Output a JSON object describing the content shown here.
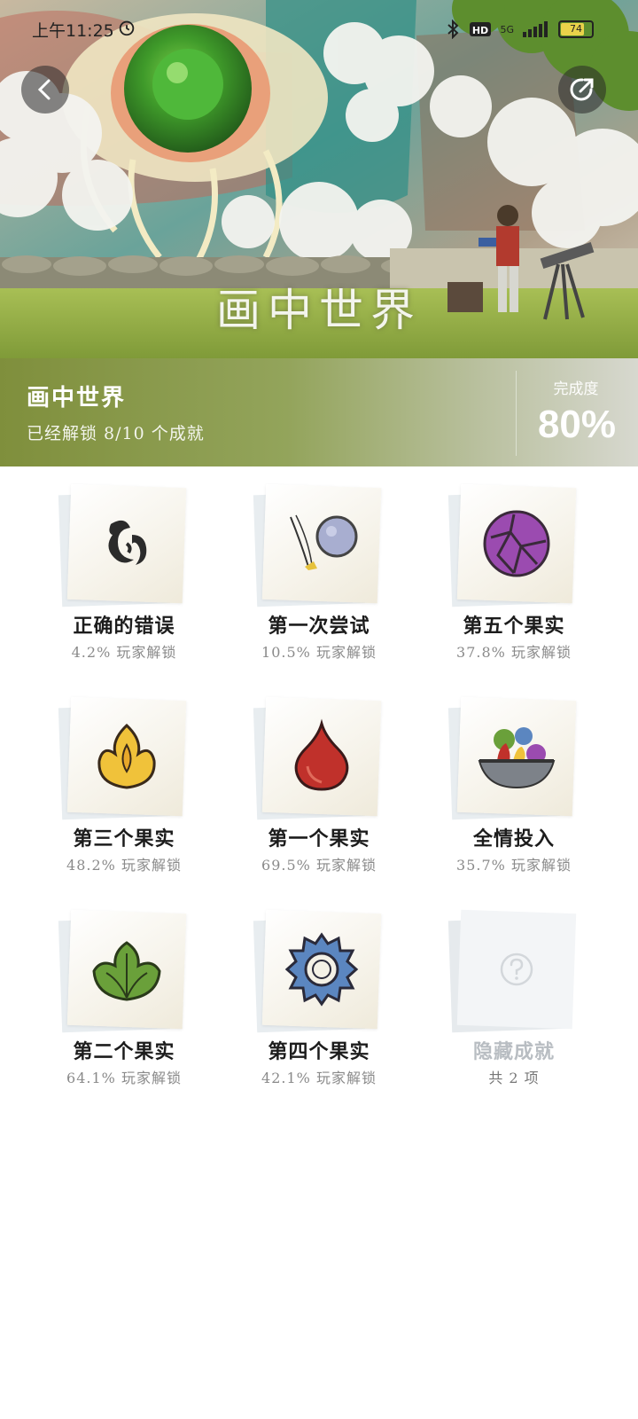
{
  "status_bar": {
    "time": "上午11:25",
    "battery": "74",
    "network": "5G"
  },
  "hero": {
    "title_art_text": "画中世界"
  },
  "summary": {
    "game_name": "画中世界",
    "unlocked_text": "已经解锁 8/10 个成就",
    "completion_label": "完成度",
    "completion_value": "80%"
  },
  "achievements": [
    {
      "name": "正确的错误",
      "rate": "4.2% 玩家解锁",
      "icon": "swirl-glyph-icon"
    },
    {
      "name": "第一次尝试",
      "rate": "10.5% 玩家解锁",
      "icon": "thrown-ball-icon"
    },
    {
      "name": "第五个果实",
      "rate": "37.8% 玩家解锁",
      "icon": "purple-fruit-icon"
    },
    {
      "name": "第三个果实",
      "rate": "48.2% 玩家解锁",
      "icon": "flame-fruit-icon"
    },
    {
      "name": "第一个果实",
      "rate": "69.5% 玩家解锁",
      "icon": "red-drop-fruit-icon"
    },
    {
      "name": "全情投入",
      "rate": "35.7% 玩家解锁",
      "icon": "fruit-bowl-icon"
    },
    {
      "name": "第二个果实",
      "rate": "64.1% 玩家解锁",
      "icon": "green-leaf-fruit-icon"
    },
    {
      "name": "第四个果实",
      "rate": "42.1% 玩家解锁",
      "icon": "blue-gear-fruit-icon"
    },
    {
      "name": "隐藏成就",
      "rate": "共 2 项",
      "icon": "question-mark-icon"
    }
  ]
}
